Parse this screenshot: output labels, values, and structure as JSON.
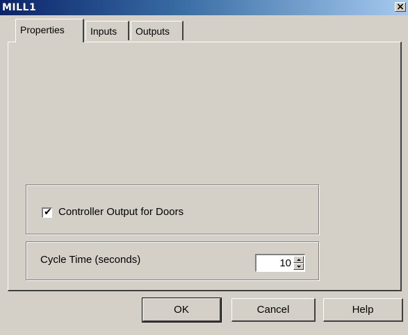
{
  "window": {
    "title": "MILL1",
    "close_glyph": "×"
  },
  "tabs": [
    {
      "label": "Properties",
      "active": true
    },
    {
      "label": "Inputs",
      "active": false
    },
    {
      "label": "Outputs",
      "active": false
    }
  ],
  "properties": {
    "controller_output": {
      "label": "Controller Output for Doors",
      "checked": true,
      "check_glyph": "✔"
    },
    "cycle_time": {
      "label": "Cycle Time (seconds)",
      "value": "10"
    }
  },
  "buttons": {
    "ok": "OK",
    "cancel": "Cancel",
    "help": "Help"
  },
  "colors": {
    "face": "#d4d0c8",
    "title_start": "#0a246a",
    "title_end": "#a6caf0"
  }
}
